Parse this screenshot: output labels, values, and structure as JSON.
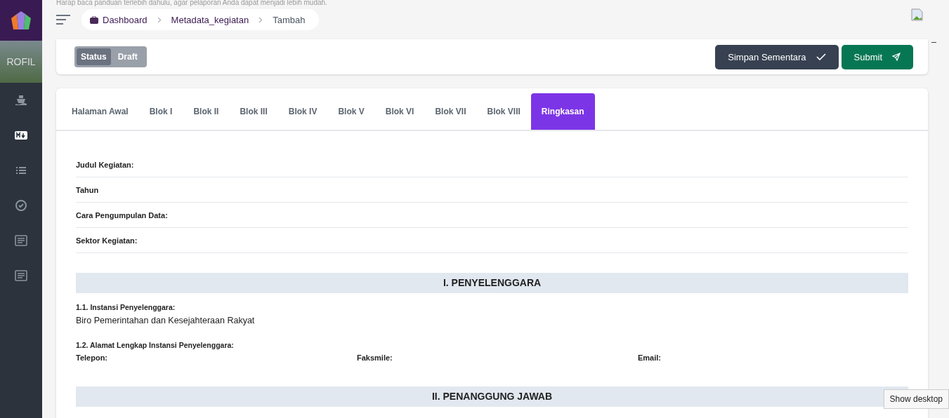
{
  "notice": "Harap baca panduan terlebih dahulu, agar pelaporan Anda dapat menjadi lebih mudah.",
  "sidebar": {
    "brand_text": "ROFIL"
  },
  "breadcrumb": [
    "Dashboard",
    "Metadata_kegiatan",
    "Tambah"
  ],
  "status": {
    "label": "Status",
    "value": "Draft"
  },
  "buttons": [
    {
      "label": "Simpan Sementara",
      "kind": "save"
    },
    {
      "label": "Submit",
      "kind": "submit"
    }
  ],
  "tabs": [
    {
      "label": "Halaman Awal",
      "selected": false
    },
    {
      "label": "Blok I",
      "selected": false
    },
    {
      "label": "Blok II",
      "selected": false
    },
    {
      "label": "Blok III",
      "selected": false
    },
    {
      "label": "Blok IV",
      "selected": false
    },
    {
      "label": "Blok V",
      "selected": false
    },
    {
      "label": "Blok VI",
      "selected": false
    },
    {
      "label": "Blok VII",
      "selected": false
    },
    {
      "label": "Blok VIII",
      "selected": false
    },
    {
      "label": "Ringkasan",
      "selected": true
    }
  ],
  "summary_fields": [
    "Judul Kegiatan:",
    "Tahun",
    "Cara Pengumpulan Data:",
    "Sektor Kegiatan:"
  ],
  "sections": [
    {
      "title": "I. PENYELENGGARA",
      "items": [
        {
          "kind": "field",
          "label": "1.1. Instansi Penyelenggara:",
          "value": "Biro Pemerintahan dan Kesejahteraan Rakyat"
        },
        {
          "kind": "address",
          "label": "1.2. Alamat Lengkap Instansi Penyelenggara:",
          "columns": [
            "Telepon:",
            "Faksmile:",
            "Email:"
          ]
        }
      ]
    },
    {
      "title": "II. PENANGGUNG JAWAB"
    }
  ],
  "tooltip": "Show desktop"
}
